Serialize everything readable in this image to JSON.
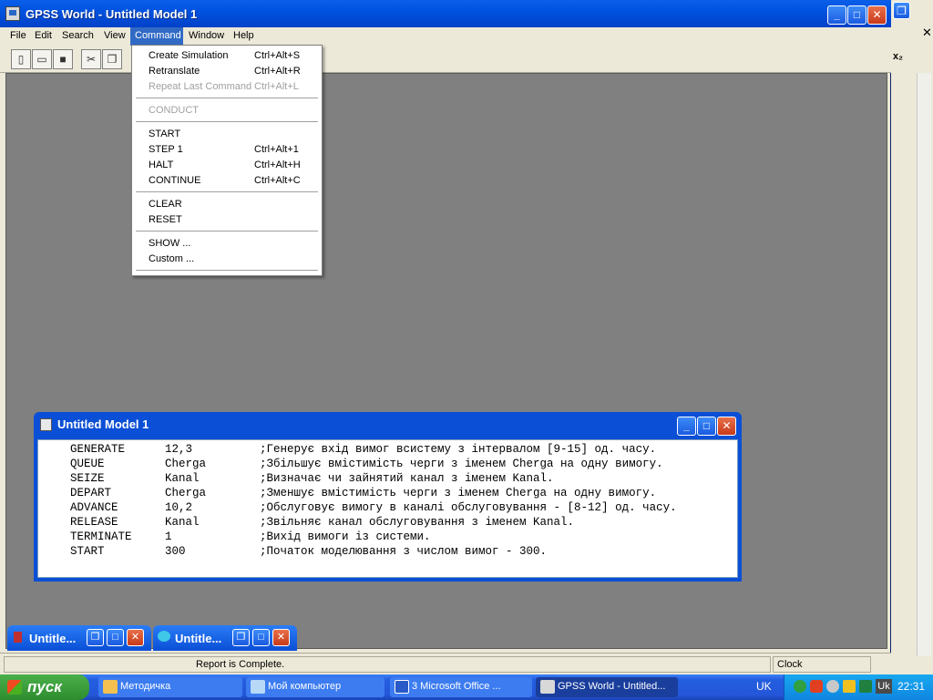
{
  "app": {
    "title": "GPSS World - Untitled Model 1",
    "controls": {
      "minimize": "_",
      "maximize": "□",
      "close": "✕"
    }
  },
  "menubar": {
    "items": [
      "File",
      "Edit",
      "Search",
      "View",
      "Command",
      "Window",
      "Help"
    ],
    "active": "Command"
  },
  "toolbar": {
    "icons": [
      "new-file-icon",
      "open-folder-icon",
      "save-disk-icon",
      "cut-icon",
      "copy-icon"
    ]
  },
  "command_menu": {
    "groups": [
      [
        {
          "label": "Create Simulation",
          "shortcut": "Ctrl+Alt+S",
          "enabled": true
        },
        {
          "label": "Retranslate",
          "shortcut": "Ctrl+Alt+R",
          "enabled": true
        },
        {
          "label": "Repeat Last Command",
          "shortcut": "Ctrl+Alt+L",
          "enabled": false
        }
      ],
      [
        {
          "label": "CONDUCT",
          "shortcut": "",
          "enabled": false
        }
      ],
      [
        {
          "label": "START",
          "shortcut": "",
          "enabled": true
        },
        {
          "label": "STEP 1",
          "shortcut": "Ctrl+Alt+1",
          "enabled": true
        },
        {
          "label": "HALT",
          "shortcut": "Ctrl+Alt+H",
          "enabled": true
        },
        {
          "label": "CONTINUE",
          "shortcut": "Ctrl+Alt+C",
          "enabled": true
        }
      ],
      [
        {
          "label": "CLEAR",
          "shortcut": "",
          "enabled": true
        },
        {
          "label": "RESET",
          "shortcut": "",
          "enabled": true
        }
      ],
      [
        {
          "label": "SHOW ...",
          "shortcut": "",
          "enabled": true
        },
        {
          "label": "Custom ...",
          "shortcut": "",
          "enabled": true
        }
      ]
    ]
  },
  "model_window": {
    "title": "Untitled Model 1",
    "lines": [
      {
        "op": "GENERATE",
        "arg": "12,3",
        "comment": ";Генерує вхід вимог всистему з інтервалом [9-15] од. часу."
      },
      {
        "op": "QUEUE",
        "arg": "Cherga",
        "comment": ";Збільшує вмістимість черги з іменем Cherga на одну вимогу."
      },
      {
        "op": "SEIZE",
        "arg": "Kanal",
        "comment": ";Визначає чи зайнятий канал з іменем Kanal."
      },
      {
        "op": "DEPART",
        "arg": "Cherga",
        "comment": ";Зменшує вмістимість черги з іменем Cherga на одну вимогу."
      },
      {
        "op": "ADVANCE",
        "arg": "10,2",
        "comment": ";Обслуговує вимогу в каналі обслуговування - [8-12] од. часу."
      },
      {
        "op": "RELEASE",
        "arg": "Kanal",
        "comment": ";Звільняє канал обслуговування з іменем Kanal."
      },
      {
        "op": "TERMINATE",
        "arg": "1",
        "comment": ";Вихід вимоги із системи."
      },
      {
        "op": "START",
        "arg": "300",
        "comment": ";Початок моделювання з числом вимог - 300."
      }
    ]
  },
  "minimized_windows": [
    {
      "label": "Untitle..."
    },
    {
      "label": "Untitle..."
    }
  ],
  "statusbar": {
    "message": "Report is Complete.",
    "clock": "Clock"
  },
  "taskbar": {
    "start": "пуск",
    "buttons": [
      {
        "label": "Методичка",
        "active": false
      },
      {
        "label": "Мой компьютер",
        "active": false
      },
      {
        "label": "3 Microsoft Office ...",
        "active": false
      },
      {
        "label": "GPSS World - Untitled...",
        "active": true
      }
    ],
    "language": "UK",
    "tray_lang": "Uk",
    "time": "22:31"
  },
  "colors": {
    "titlebar": "#0053e0",
    "workspace": "#808080",
    "menu_highlight": "#316ac5",
    "taskbar": "#245ee0",
    "start_button": "#2e8c2e"
  }
}
